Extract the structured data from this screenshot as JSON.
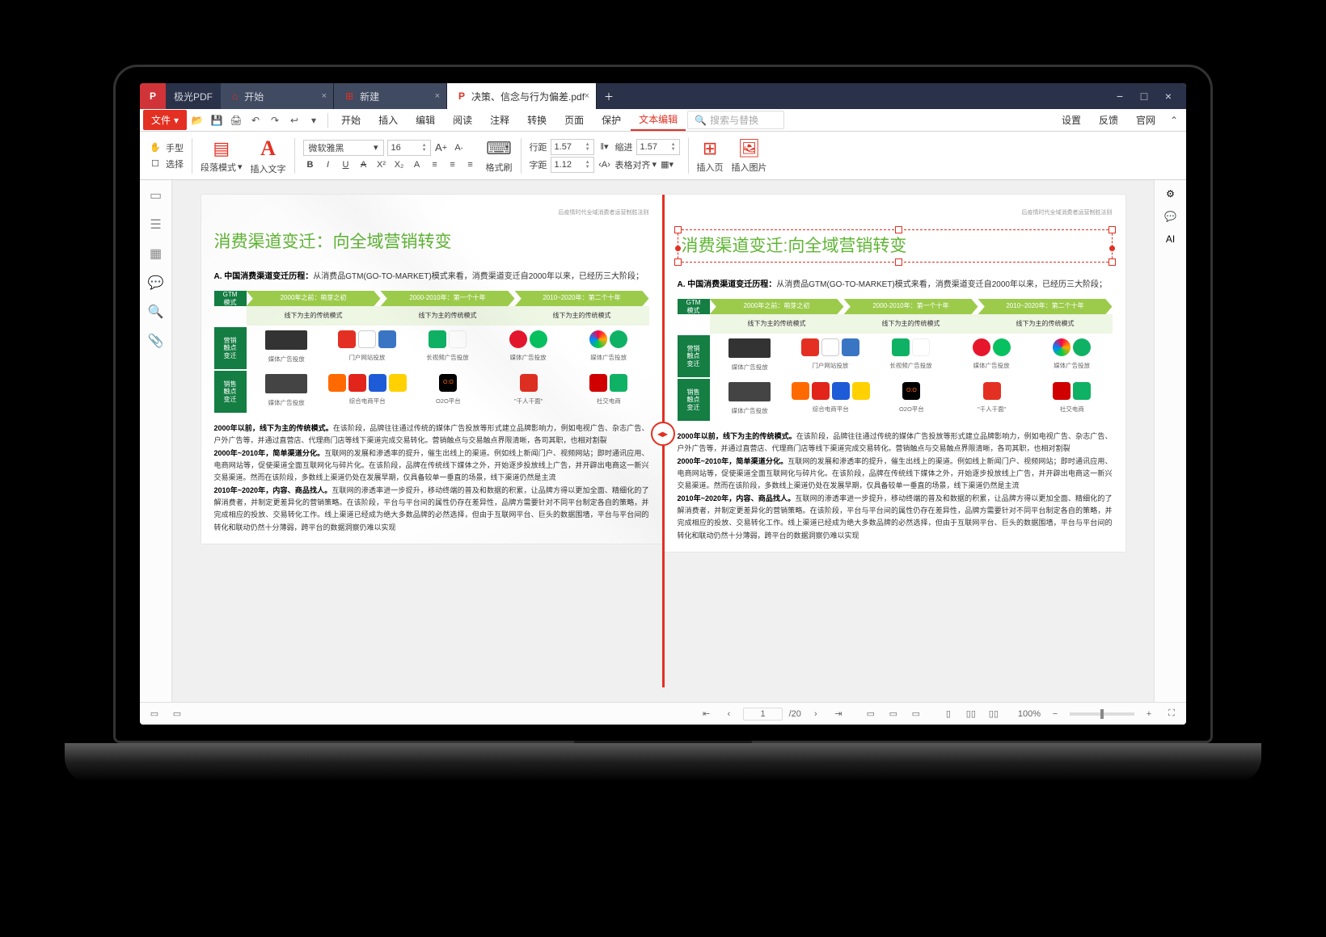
{
  "app": {
    "name": "极光PDF"
  },
  "tabs": [
    {
      "icon": "⌂",
      "label": "开始"
    },
    {
      "icon": "⊕",
      "label": "新建"
    },
    {
      "icon": "P",
      "label": "决策、信念与行为偏差.pdf",
      "active": true
    }
  ],
  "menu": {
    "file": "文件",
    "items": [
      "开始",
      "插入",
      "编辑",
      "阅读",
      "注释",
      "转换",
      "页面",
      "保护",
      "文本编辑"
    ],
    "active": "文本编辑",
    "search_placeholder": "搜索与替换",
    "right": [
      "设置",
      "反馈",
      "官网"
    ]
  },
  "ribbon": {
    "hand": "手型",
    "select": "选择",
    "para_mode": "段落模式",
    "insert_text": "插入文字",
    "font": "微软雅黑",
    "font_size": "16",
    "format_brush": "格式刷",
    "line_height_label": "行距",
    "line_height": "1.57",
    "indent_label": "缩进",
    "indent": "1.57",
    "char_space_label": "字距",
    "char_space": "1.12",
    "table_align": "表格对齐",
    "insert_page": "插入页",
    "insert_image": "插入图片"
  },
  "doc": {
    "header": "后疫情时代全域消费者运营制胜法则",
    "title": "消费渠道变迁：向全域营销转变",
    "title_edit": "消费渠道变迁:向全域营销转变",
    "subtitle_label": "A. 中国消费渠道变迁历程：",
    "subtitle_body": "从消费品GTM(GO-TO-MARKET)模式来看，消费渠道变迁自2000年以来，已经历三大阶段；",
    "gtm": {
      "row_label_1": "GTM\n模式",
      "row_label_2": "营销\n触点\n变迁",
      "row_label_3": "销售\n触点\n变迁",
      "heads": [
        "2000年之前：萌芽之初",
        "2000-2010年：第一个十年",
        "2010~2020年：第二个十年"
      ],
      "sub": "线下为主的传统模式",
      "cap1": [
        "媒体广告投放",
        "门户网站投放",
        "长视频广告投放",
        "媒体广告投放",
        "媒体广告投放"
      ],
      "cap2": [
        "媒体广告投放",
        "综合电商平台",
        "O2O平台",
        "\"千人千面\"",
        "社交电商"
      ]
    },
    "paras": [
      {
        "b": "2000年以前，线下为主的传统模式。",
        "t": "在该阶段，品牌往往通过传统的媒体广告投放等形式建立品牌影响力，例如电视广告、杂志广告、户外广告等，并通过直营店、代理商门店等线下渠道完成交易转化。营销触点与交易触点界限清晰，各司其职，也相对割裂"
      },
      {
        "b": "2000年~2010年，简单渠道分化。",
        "t": "互联网的发展和渗透率的提升，催生出线上的渠道。例如线上新闻门户、视频网站；即时通讯应用、电商网站等，促使渠道全面互联网化与碎片化。在该阶段，品牌在传统线下媒体之外，开始逐步投放线上广告，并开辟出电商这一新兴交易渠道。然而在该阶段，多数线上渠道仍处在发展早期，仅具备较单一垂直的场景，线下渠道仍然是主流"
      },
      {
        "b": "2010年~2020年，内容、商品找人。",
        "t": "互联网的渗透率进一步提升，移动终端的普及和数据的积累，让品牌方得以更加全面、精细化的了解消费者，并制定更差异化的营销策略。在该阶段，平台与平台间的属性仍存在差异性，品牌方需要针对不同平台制定各自的策略，并完成相应的投放、交易转化工作。线上渠道已经成为绝大多数品牌的必然选择，但由于互联网平台、巨头的数据围墙，平台与平台间的转化和联动仍然十分薄弱，跨平台的数据洞察仍难以实现"
      }
    ]
  },
  "status": {
    "page_num": "1",
    "page_total": "/20",
    "zoom": "100%"
  }
}
